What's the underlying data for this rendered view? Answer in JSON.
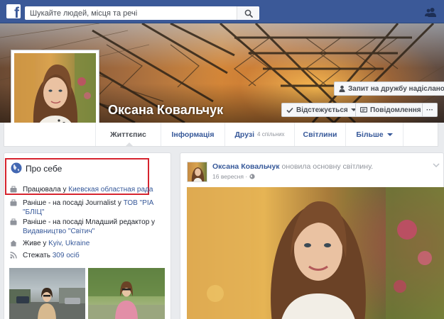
{
  "topbar": {
    "logo_glyph": "f",
    "search_placeholder": "Шукайте людей, місця та речі",
    "icons": {
      "search": "search-icon",
      "friends": "friend-requests-icon"
    },
    "brand_color": "#3b5998"
  },
  "profile": {
    "name": "Оксана Ковальчук",
    "friend_request_label": "Запит на дружбу надіслано",
    "follow_label": "Відстежується",
    "message_label": "Повідомлення",
    "more_label": "···"
  },
  "tabs": [
    {
      "label": "Життєпис",
      "active": true
    },
    {
      "label": "Інформація"
    },
    {
      "label": "Друзі",
      "sub": "4 спільних"
    },
    {
      "label": "Світлини"
    },
    {
      "label": "Більше"
    }
  ],
  "about": {
    "title": "Про себе",
    "rows": [
      {
        "icon": "work-icon",
        "prefix": "Працювала у ",
        "link": "Киевская областная рада",
        "suffix": ""
      },
      {
        "icon": "work-icon",
        "prefix": "Раніше - на посаді Journalist у ",
        "link": "ТОВ \"РІА \"БЛІЦ\"",
        "suffix": ""
      },
      {
        "icon": "work-icon",
        "prefix": "Раніше - на посаді Младший редактор у ",
        "link": "Видавництво \"Світич\"",
        "suffix": ""
      },
      {
        "icon": "home-icon",
        "prefix": "Живе у ",
        "link": "Kyiv, Ukraine",
        "suffix": ""
      },
      {
        "icon": "rss-icon",
        "prefix": "Стежать ",
        "link": "309 осіб",
        "suffix": ""
      }
    ]
  },
  "post": {
    "author": "Оксана Ковальчук",
    "action": "оновила основну світлину.",
    "date": "16 вересня · "
  }
}
